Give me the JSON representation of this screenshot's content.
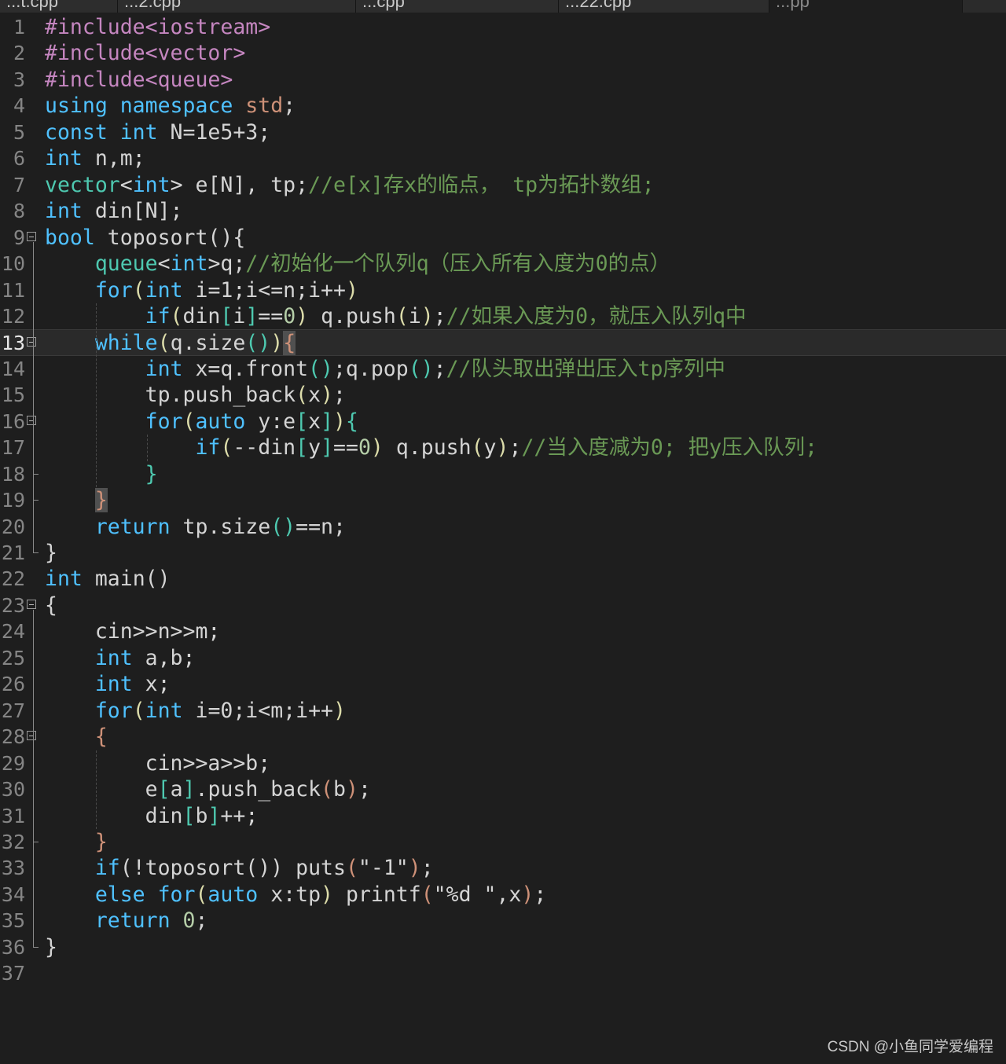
{
  "tabs": [
    "...t.cpp",
    "...2.cpp",
    "...cpp",
    "...22.cpp",
    "...pp"
  ],
  "current_line": 13,
  "colors": {
    "background": "#1e1e1e",
    "text": "#d4d4d4",
    "keyword": "#4fc1ff",
    "type": "#4ec9b0",
    "directive": "#c586c0",
    "number": "#b5cea8",
    "string": "#ce9178",
    "comment": "#6a9955",
    "line_number": "#858585",
    "bracket": "#dcdcaa"
  },
  "code_lines": [
    [
      {
        "t": "#include<iostream>",
        "k": "dir"
      }
    ],
    [
      {
        "t": "#include<vector>",
        "k": "dir"
      }
    ],
    [
      {
        "t": "#include<queue>",
        "k": "dir"
      }
    ],
    [
      {
        "t": "using namespace ",
        "k": "kw"
      },
      {
        "t": "std",
        "k": "str"
      },
      {
        "t": ";",
        "k": "pl"
      }
    ],
    [
      {
        "t": "const int ",
        "k": "kw"
      },
      {
        "t": "N=1e5+3;",
        "k": "pl"
      }
    ],
    [
      {
        "t": "int ",
        "k": "kw"
      },
      {
        "t": "n,m;",
        "k": "pl"
      }
    ],
    [
      {
        "t": "vector",
        "k": "ty"
      },
      {
        "t": "<",
        "k": "pl"
      },
      {
        "t": "int",
        "k": "kw"
      },
      {
        "t": "> e[N], tp;",
        "k": "pl"
      },
      {
        "t": "//e[x]存x的临点， tp为拓扑数组;",
        "k": "cm"
      }
    ],
    [
      {
        "t": "int ",
        "k": "kw"
      },
      {
        "t": "din[N];",
        "k": "pl"
      }
    ],
    [
      {
        "t": "bool ",
        "k": "kw"
      },
      {
        "t": "toposort(){",
        "k": "pl"
      }
    ],
    [
      {
        "t": "    queue",
        "k": "ty"
      },
      {
        "t": "<",
        "k": "pl"
      },
      {
        "t": "int",
        "k": "kw"
      },
      {
        "t": ">q;",
        "k": "pl"
      },
      {
        "t": "//初始化一个队列q（压入所有入度为0的点）",
        "k": "cm"
      }
    ],
    [
      {
        "t": "    for",
        "k": "kw"
      },
      {
        "t": "(",
        "k": "br"
      },
      {
        "t": "int ",
        "k": "kw"
      },
      {
        "t": "i=1;i<=n;i++",
        "k": "pl"
      },
      {
        "t": ")",
        "k": "br"
      }
    ],
    [
      {
        "t": "        if",
        "k": "kw"
      },
      {
        "t": "(",
        "k": "br"
      },
      {
        "t": "din",
        "k": "pl"
      },
      {
        "t": "[",
        "k": "ty"
      },
      {
        "t": "i",
        "k": "pl"
      },
      {
        "t": "]",
        "k": "ty"
      },
      {
        "t": "==",
        "k": "pl"
      },
      {
        "t": "0",
        "k": "num"
      },
      {
        "t": ") ",
        "k": "br"
      },
      {
        "t": "q.push",
        "k": "pl"
      },
      {
        "t": "(",
        "k": "br"
      },
      {
        "t": "i",
        "k": "pl"
      },
      {
        "t": ")",
        "k": "br"
      },
      {
        "t": ";",
        "k": "pl"
      },
      {
        "t": "//如果入度为0，就压入队列q中",
        "k": "cm"
      }
    ],
    [
      {
        "t": "    while",
        "k": "kw"
      },
      {
        "t": "(",
        "k": "br"
      },
      {
        "t": "q.size",
        "k": "pl"
      },
      {
        "t": "()",
        "k": "ty"
      },
      {
        "t": ")",
        "k": "br"
      },
      {
        "t": "{",
        "k": "hl"
      }
    ],
    [
      {
        "t": "        int ",
        "k": "kw"
      },
      {
        "t": "x=q.front",
        "k": "pl"
      },
      {
        "t": "()",
        "k": "ty"
      },
      {
        "t": ";q.pop",
        "k": "pl"
      },
      {
        "t": "()",
        "k": "ty"
      },
      {
        "t": ";",
        "k": "pl"
      },
      {
        "t": "//队头取出弹出压入tp序列中",
        "k": "cm"
      }
    ],
    [
      {
        "t": "        tp.push_back",
        "k": "pl"
      },
      {
        "t": "(",
        "k": "br"
      },
      {
        "t": "x",
        "k": "pl"
      },
      {
        "t": ")",
        "k": "br"
      },
      {
        "t": ";",
        "k": "pl"
      }
    ],
    [
      {
        "t": "        for",
        "k": "kw"
      },
      {
        "t": "(",
        "k": "br"
      },
      {
        "t": "auto ",
        "k": "kw"
      },
      {
        "t": "y:e",
        "k": "pl"
      },
      {
        "t": "[",
        "k": "ty"
      },
      {
        "t": "x",
        "k": "pl"
      },
      {
        "t": "]",
        "k": "ty"
      },
      {
        "t": ")",
        "k": "br"
      },
      {
        "t": "{",
        "k": "ty"
      }
    ],
    [
      {
        "t": "            if",
        "k": "kw"
      },
      {
        "t": "(",
        "k": "br"
      },
      {
        "t": "--din",
        "k": "pl"
      },
      {
        "t": "[",
        "k": "ty"
      },
      {
        "t": "y",
        "k": "pl"
      },
      {
        "t": "]",
        "k": "ty"
      },
      {
        "t": "==",
        "k": "pl"
      },
      {
        "t": "0",
        "k": "num"
      },
      {
        "t": ") ",
        "k": "br"
      },
      {
        "t": "q.push",
        "k": "pl"
      },
      {
        "t": "(",
        "k": "br"
      },
      {
        "t": "y",
        "k": "pl"
      },
      {
        "t": ")",
        "k": "br"
      },
      {
        "t": ";",
        "k": "pl"
      },
      {
        "t": "//当入度减为0; 把y压入队列;",
        "k": "cm"
      }
    ],
    [
      {
        "t": "        }",
        "k": "ty"
      }
    ],
    [
      {
        "t": "    ",
        "k": "pl"
      },
      {
        "t": "}",
        "k": "hl"
      }
    ],
    [
      {
        "t": "    return ",
        "k": "kw"
      },
      {
        "t": "tp.size",
        "k": "pl"
      },
      {
        "t": "()",
        "k": "ty"
      },
      {
        "t": "==n;",
        "k": "pl"
      }
    ],
    [
      {
        "t": "}",
        "k": "pl"
      }
    ],
    [
      {
        "t": "int ",
        "k": "kw"
      },
      {
        "t": "main()",
        "k": "pl"
      }
    ],
    [
      {
        "t": "{",
        "k": "pl"
      }
    ],
    [
      {
        "t": "    cin>>n>>m;",
        "k": "pl"
      }
    ],
    [
      {
        "t": "    int ",
        "k": "kw"
      },
      {
        "t": "a,b;",
        "k": "pl"
      }
    ],
    [
      {
        "t": "    int ",
        "k": "kw"
      },
      {
        "t": "x;",
        "k": "pl"
      }
    ],
    [
      {
        "t": "    for",
        "k": "kw"
      },
      {
        "t": "(",
        "k": "br"
      },
      {
        "t": "int ",
        "k": "kw"
      },
      {
        "t": "i=0;i<m;i++",
        "k": "pl"
      },
      {
        "t": ")",
        "k": "br"
      }
    ],
    [
      {
        "t": "    {",
        "k": "str"
      }
    ],
    [
      {
        "t": "        cin>>a>>b;",
        "k": "pl"
      }
    ],
    [
      {
        "t": "        e",
        "k": "pl"
      },
      {
        "t": "[",
        "k": "ty"
      },
      {
        "t": "a",
        "k": "pl"
      },
      {
        "t": "]",
        "k": "ty"
      },
      {
        "t": ".push_back",
        "k": "pl"
      },
      {
        "t": "(",
        "k": "str"
      },
      {
        "t": "b",
        "k": "pl"
      },
      {
        "t": ")",
        "k": "str"
      },
      {
        "t": ";",
        "k": "pl"
      }
    ],
    [
      {
        "t": "        din",
        "k": "pl"
      },
      {
        "t": "[",
        "k": "ty"
      },
      {
        "t": "b",
        "k": "pl"
      },
      {
        "t": "]",
        "k": "ty"
      },
      {
        "t": "++;",
        "k": "pl"
      }
    ],
    [
      {
        "t": "    }",
        "k": "str"
      }
    ],
    [
      {
        "t": "    if",
        "k": "kw"
      },
      {
        "t": "(!toposort()) ",
        "k": "pl"
      },
      {
        "t": "puts",
        "k": "pl"
      },
      {
        "t": "(",
        "k": "str"
      },
      {
        "t": "\"-1\"",
        "k": "pl"
      },
      {
        "t": ")",
        "k": "str"
      },
      {
        "t": ";",
        "k": "pl"
      }
    ],
    [
      {
        "t": "    else for",
        "k": "kw"
      },
      {
        "t": "(",
        "k": "br"
      },
      {
        "t": "auto ",
        "k": "kw"
      },
      {
        "t": "x:tp",
        "k": "pl"
      },
      {
        "t": ") ",
        "k": "br"
      },
      {
        "t": "printf",
        "k": "pl"
      },
      {
        "t": "(",
        "k": "str"
      },
      {
        "t": "\"%d \"",
        "k": "pl"
      },
      {
        "t": ",x",
        "k": "pl"
      },
      {
        "t": ")",
        "k": "str"
      },
      {
        "t": ";",
        "k": "pl"
      }
    ],
    [
      {
        "t": "    return ",
        "k": "kw"
      },
      {
        "t": "0",
        "k": "num"
      },
      {
        "t": ";",
        "k": "pl"
      }
    ],
    [
      {
        "t": "}",
        "k": "pl"
      }
    ],
    [
      {
        "t": "",
        "k": "pl"
      }
    ]
  ],
  "fold_markers": [
    9,
    13,
    16,
    23,
    28
  ],
  "watermark": "CSDN @小鱼同学爱编程"
}
